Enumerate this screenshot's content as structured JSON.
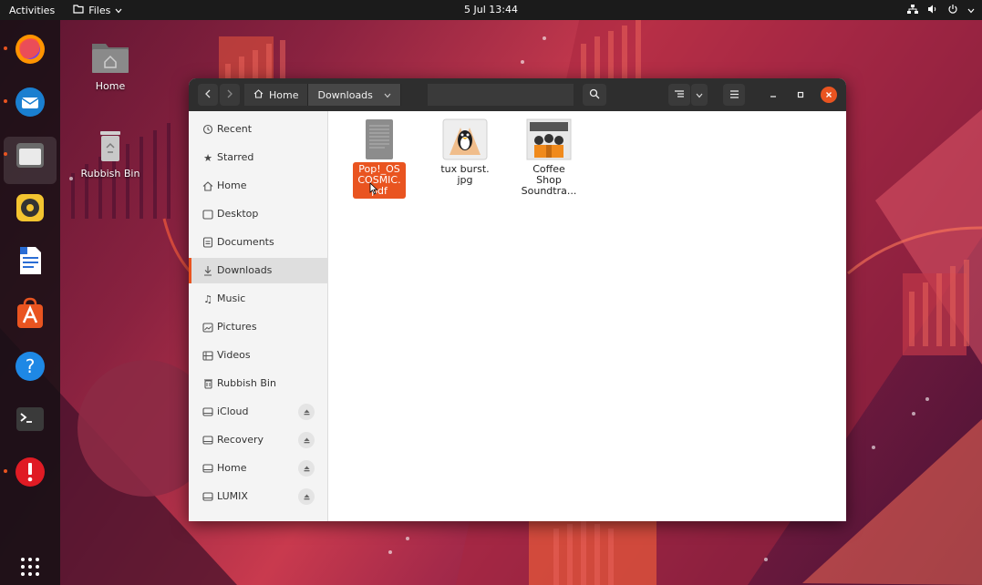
{
  "topbar": {
    "activities": "Activities",
    "app_menu": "Files",
    "clock": "5 Jul  13:44"
  },
  "dock": {
    "apps": [
      "firefox-icon",
      "thunderbird-icon",
      "files-icon",
      "rhythmbox-icon",
      "writer-icon",
      "software-icon",
      "help-icon",
      "terminal-icon",
      "update-icon",
      "app-grid-icon"
    ]
  },
  "desktop": {
    "icons": [
      {
        "label": "Home"
      },
      {
        "label": "Rubbish Bin"
      }
    ]
  },
  "files_window": {
    "pathbar": {
      "home": "Home",
      "current": "Downloads"
    },
    "sidebar": {
      "places": [
        {
          "label": "Recent",
          "icon": "clock-icon"
        },
        {
          "label": "Starred",
          "icon": "star-icon"
        },
        {
          "label": "Home",
          "icon": "home-icon"
        },
        {
          "label": "Desktop",
          "icon": "desktop-icon"
        },
        {
          "label": "Documents",
          "icon": "document-icon"
        },
        {
          "label": "Downloads",
          "icon": "download-icon",
          "selected": true
        },
        {
          "label": "Music",
          "icon": "music-icon"
        },
        {
          "label": "Pictures",
          "icon": "picture-icon"
        },
        {
          "label": "Videos",
          "icon": "video-icon"
        },
        {
          "label": "Rubbish Bin",
          "icon": "trash-icon"
        }
      ],
      "drives": [
        {
          "label": "iCloud"
        },
        {
          "label": "Recovery"
        },
        {
          "label": "Home"
        },
        {
          "label": "LUMIX"
        }
      ]
    },
    "files": [
      {
        "name": "Pop!_OS COSMIC.pdf",
        "line1": "Pop!_OS",
        "line2": "COSMIC.",
        "line3": "pdf",
        "selected": true
      },
      {
        "name": "tux burst.jpg",
        "line1": "tux burst.",
        "line2": "jpg"
      },
      {
        "name": "Coffee Shop Soundtrack",
        "line1": "Coffee",
        "line2": "Shop",
        "line3": "Soundtra..."
      }
    ]
  },
  "colors": {
    "accent": "#e95420",
    "headerbar": "#2e2e2e",
    "sidebar": "#f4f4f4"
  }
}
